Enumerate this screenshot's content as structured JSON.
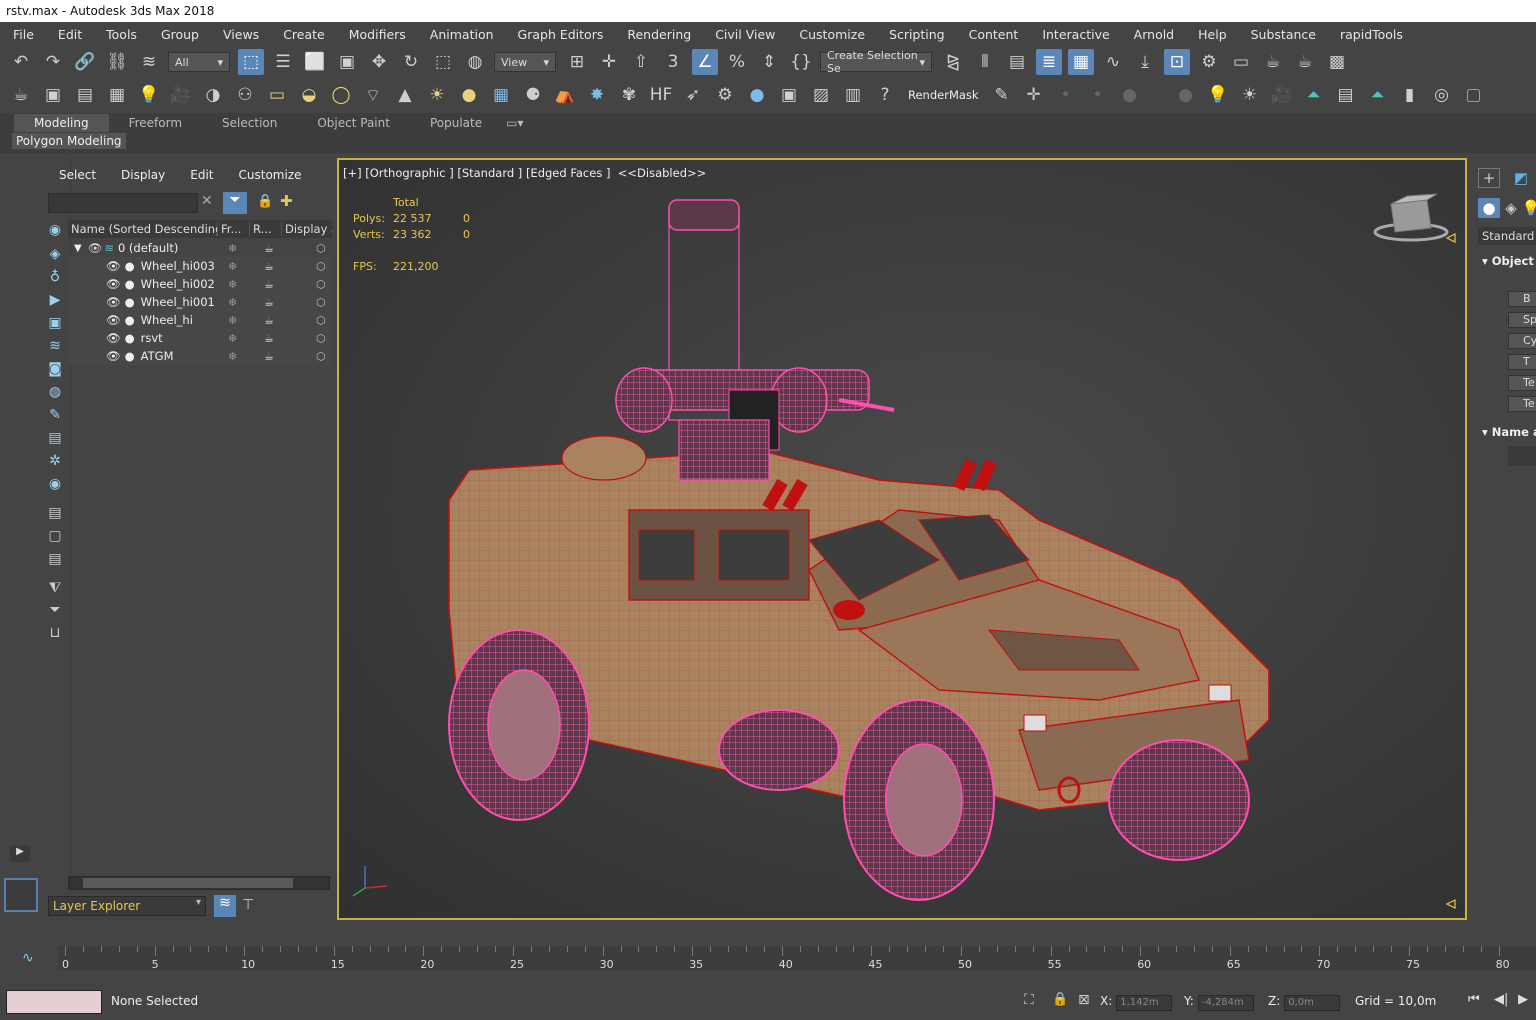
{
  "window": {
    "title": "rstv.max - Autodesk 3ds Max 2018"
  },
  "menu": [
    "File",
    "Edit",
    "Tools",
    "Group",
    "Views",
    "Create",
    "Modifiers",
    "Animation",
    "Graph Editors",
    "Rendering",
    "Civil View",
    "Customize",
    "Scripting",
    "Content",
    "Interactive",
    "Arnold",
    "Help",
    "Substance",
    "rapidTools"
  ],
  "toolbar": {
    "filter_value": "All",
    "view_value": "View",
    "selection_set_value": "Create Selection Se",
    "render_mask_label": "RenderMask"
  },
  "ribbon": {
    "tabs": [
      "Modeling",
      "Freeform",
      "Selection",
      "Object Paint",
      "Populate"
    ],
    "sub": "Polygon Modeling"
  },
  "scene_explorer": {
    "menu": [
      "Select",
      "Display",
      "Edit",
      "Customize"
    ],
    "columns": [
      "Name (Sorted Descending)",
      "Fr...",
      "R...",
      "Display a"
    ],
    "layer": "0 (default)",
    "rows": [
      "Wheel_hi003",
      "Wheel_hi002",
      "Wheel_hi001",
      "Wheel_hi",
      "rsvt",
      "ATGM"
    ],
    "bottom_dropdown": "Layer Explorer"
  },
  "viewport": {
    "label": "[+] [Orthographic ] [Standard ] [Edged Faces ]  <<Disabled>>",
    "stats_header": "Total",
    "polys_label": "Polys:",
    "polys_value": "22 537",
    "polys_sel": "0",
    "verts_label": "Verts:",
    "verts_value": "23 362",
    "verts_sel": "0",
    "fps_label": "FPS:",
    "fps_value": "221,200"
  },
  "command_panel": {
    "dropdown": "Standard Pr",
    "rollout_object": "Object",
    "rollout_name": "Name a",
    "buttons": [
      "B",
      "Sp",
      "Cy",
      "T",
      "Te",
      "Te"
    ]
  },
  "timeline": {
    "ticks": [
      "0",
      "5",
      "10",
      "15",
      "20",
      "25",
      "30",
      "35",
      "40",
      "45",
      "50",
      "55",
      "60",
      "65",
      "70",
      "75",
      "80"
    ]
  },
  "status": {
    "selection": "None Selected",
    "x_label": "X:",
    "x_value": "1,142m",
    "y_label": "Y:",
    "y_value": "-4,284m",
    "z_label": "Z:",
    "z_value": "0,0m",
    "grid": "Grid = 10,0m"
  },
  "colors": {
    "viewport_border": "#c9b046",
    "stats_text": "#e6c84c",
    "wire_pink": "#ff4fb0",
    "wire_red": "#c01010",
    "body_tan": "#a98260",
    "active_tool": "#5b87b8"
  }
}
